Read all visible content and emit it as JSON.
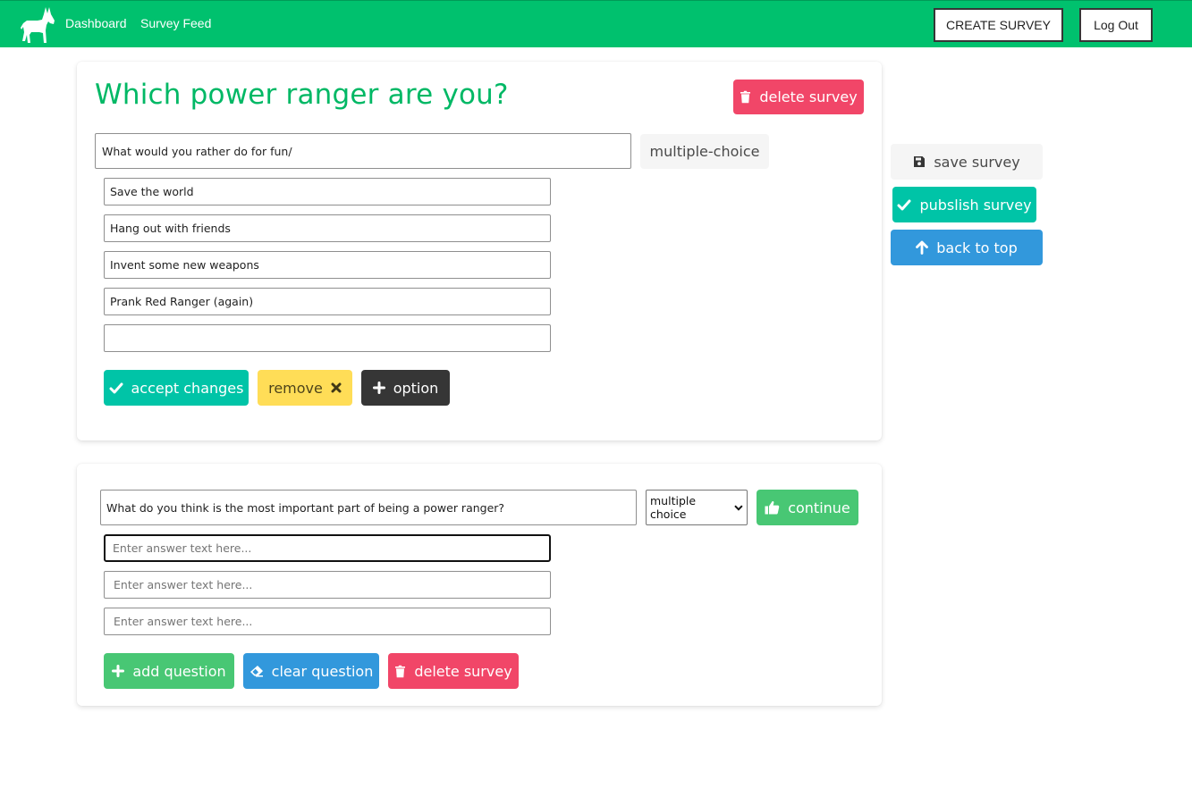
{
  "nav": {
    "logo_icon": "donkey-icon",
    "links": [
      "Dashboard",
      "Survey Feed"
    ],
    "create_survey": "CREATE SURVEY",
    "logout": "Log Out"
  },
  "survey": {
    "title": "Which power ranger are you?",
    "delete_survey": "delete survey"
  },
  "question1": {
    "text": "What would you rather do for fun/",
    "type": "multiple-choice",
    "options": [
      "Save the world",
      "Hang out with friends",
      "Invent some new weapons",
      "Prank Red Ranger (again)",
      ""
    ],
    "accept": "accept changes",
    "remove": "remove",
    "add_option": "option"
  },
  "sidebar": {
    "save": "save survey",
    "publish": "pubslish survey",
    "back": "back to top"
  },
  "question2": {
    "text": "What do you think is the most important part of being a power ranger?",
    "type_selected": "multiple choice",
    "continue": "continue",
    "placeholder": "Enter answer text here...",
    "add_question": "add question",
    "clear_question": "clear question",
    "delete_survey": "delete survey"
  },
  "colors": {
    "navbar": "#00c16e",
    "title": "#00b865",
    "danger": "#f14668",
    "primary": "#00c4a7",
    "warning": "#ffdd57",
    "dark": "#363636",
    "success": "#48c774",
    "info": "#3298dc"
  }
}
